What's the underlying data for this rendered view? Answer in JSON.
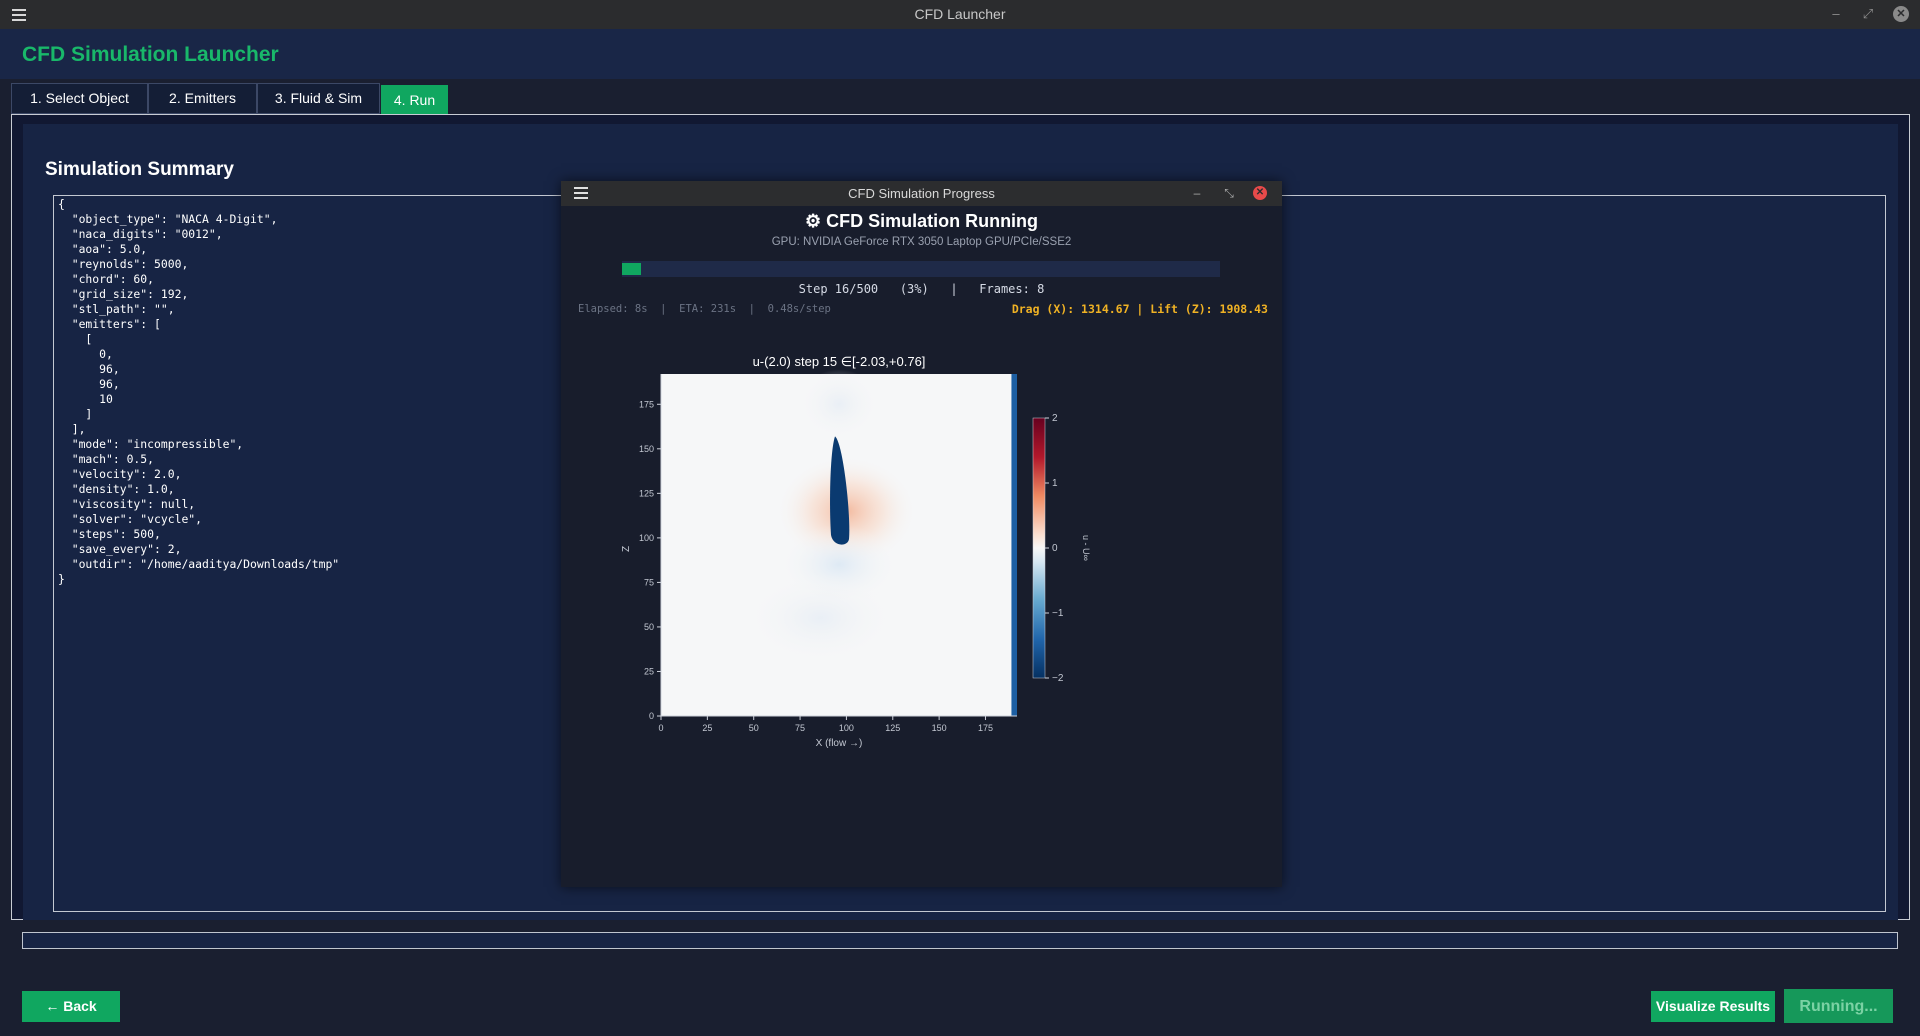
{
  "window": {
    "title": "CFD Launcher"
  },
  "app": {
    "title": "CFD Simulation Launcher"
  },
  "tabs": [
    {
      "label": "1. Select Object",
      "active": false
    },
    {
      "label": "2. Emitters",
      "active": false
    },
    {
      "label": "3. Fluid & Sim",
      "active": false
    },
    {
      "label": "4. Run",
      "active": true
    }
  ],
  "summary": {
    "title": "Simulation Summary",
    "json_text": "{\n  \"object_type\": \"NACA 4-Digit\",\n  \"naca_digits\": \"0012\",\n  \"aoa\": 5.0,\n  \"reynolds\": 5000,\n  \"chord\": 60,\n  \"grid_size\": 192,\n  \"stl_path\": \"\",\n  \"emitters\": [\n    [\n      0,\n      96,\n      96,\n      10\n    ]\n  ],\n  \"mode\": \"incompressible\",\n  \"mach\": 0.5,\n  \"velocity\": 2.0,\n  \"density\": 1.0,\n  \"viscosity\": null,\n  \"solver\": \"vcycle\",\n  \"steps\": 500,\n  \"save_every\": 2,\n  \"outdir\": \"/home/aaditya/Downloads/tmp\"\n}"
  },
  "buttons": {
    "back": "← Back",
    "visualize": "Visualize Results",
    "running": "Running..."
  },
  "colors": {
    "accent_green": "#10a760",
    "title_green": "#19b86a",
    "warning_amber": "#f0b224"
  },
  "progress_dialog": {
    "title": "CFD Simulation Progress",
    "heading": "⚙ CFD Simulation Running",
    "gpu": "GPU: NVIDIA GeForce RTX 3050 Laptop GPU/PCIe/SSE2",
    "progress_fraction": 0.032,
    "step_text": "Step 16/500   (3%)   |   Frames: 8",
    "stats_left": "Elapsed: 8s  |  ETA: 231s  |  0.48s/step",
    "forces": "Drag (X): 1314.67 | Lift (Z): 1908.43",
    "icons": {
      "menu": "menu-icon",
      "minimize": "minimize-icon",
      "restore": "restore-icon",
      "close": "close-icon"
    }
  },
  "chart_data": {
    "type": "heatmap",
    "title": "u-(2.0)  step 15  ∈[-2.03,+0.76]",
    "xlabel": "X (flow →)",
    "ylabel": "Z",
    "xlim": [
      0,
      192
    ],
    "ylim": [
      0,
      192
    ],
    "x_ticks": [
      0,
      25,
      50,
      75,
      100,
      125,
      150,
      175
    ],
    "y_ticks": [
      0,
      25,
      50,
      75,
      100,
      125,
      150,
      175
    ],
    "colorbar": {
      "label": "u - U∞",
      "range": [
        -2,
        2
      ],
      "ticks": [
        2,
        1,
        0,
        -1,
        -2
      ],
      "tick_labels": [
        "2",
        "1",
        "0",
        "−1",
        "−2"
      ],
      "colormap": "RdBu_r"
    },
    "features": {
      "airfoil_wake": {
        "x_center": 96,
        "z_top": 157,
        "z_bottom": 96,
        "value": -2.03
      },
      "stagnation_region": {
        "x": 100,
        "z": 115,
        "value": 0.76
      },
      "right_boundary_column": {
        "x_from": 189,
        "x_to": 192,
        "value": -2.03
      }
    }
  }
}
